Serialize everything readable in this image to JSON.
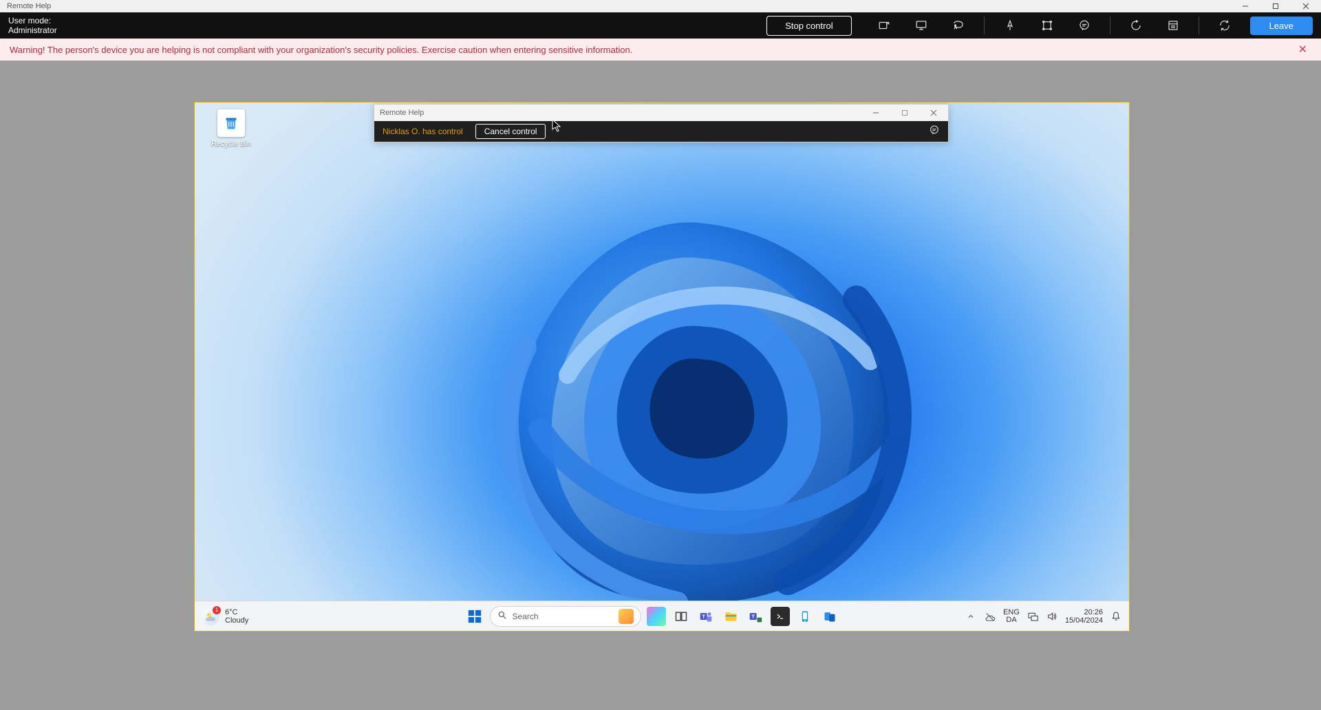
{
  "window": {
    "title": "Remote Help"
  },
  "toolbar": {
    "user_mode_label": "User mode:",
    "user_mode_value": "Administrator",
    "stop_label": "Stop control",
    "leave_label": "Leave"
  },
  "warning": {
    "text": "Warning! The person's device you are helping is not compliant with your organization's security policies. Exercise caution when entering sensitive information."
  },
  "remote": {
    "recycle_label": "Recycle Bin",
    "inner_title": "Remote Help",
    "status_text": "Nicklas O. has control",
    "cancel_label": "Cancel control"
  },
  "taskbar": {
    "weather_temp": "6°C",
    "weather_desc": "Cloudy",
    "weather_badge": "1",
    "search_placeholder": "Search",
    "lang_top": "ENG",
    "lang_bottom": "DA",
    "time": "20:26",
    "date": "15/04/2024"
  }
}
